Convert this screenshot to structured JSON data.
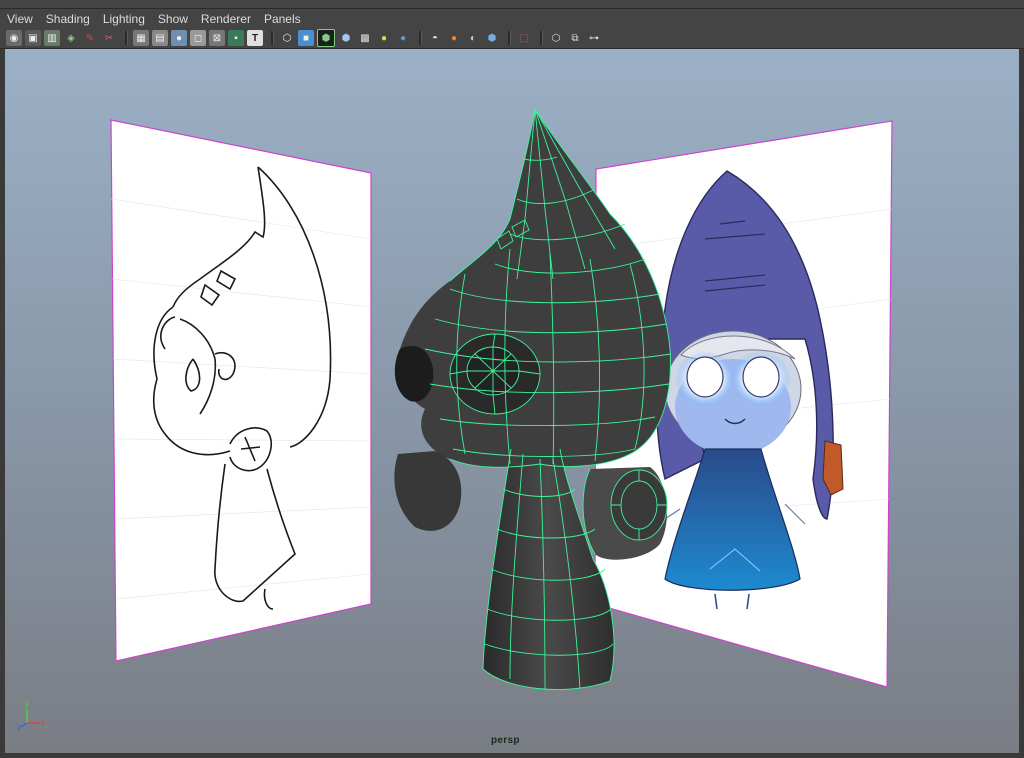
{
  "menu": {
    "items": [
      {
        "label": "View"
      },
      {
        "label": "Shading"
      },
      {
        "label": "Lighting"
      },
      {
        "label": "Show"
      },
      {
        "label": "Renderer"
      },
      {
        "label": "Panels"
      }
    ]
  },
  "toolbar": {
    "groups": [
      [
        "select-camera-icon",
        "lock-camera-icon",
        "camera-attributes-icon",
        "bookmark-icon",
        "image-plane-icon"
      ],
      [
        "grid-icon",
        "film-gate-icon",
        "resolution-gate-icon",
        "gate-mask-icon",
        "field-chart-icon",
        "safe-action-icon",
        "safe-title-icon"
      ],
      [
        "wireframe-icon",
        "smooth-shade-icon",
        "wireframe-on-shaded-icon",
        "default-material-icon",
        "textured-icon",
        "use-all-lights-icon",
        "shadows-icon"
      ],
      [
        "high-quality-icon",
        "ambient-occlusion-icon",
        "motion-blur-icon",
        "anti-aliasing-icon"
      ],
      [
        "isolate-select-icon",
        "xray-icon",
        "xray-joints-icon",
        "xray-components-icon"
      ]
    ]
  },
  "viewport": {
    "camera_label": "persp",
    "axis": {
      "y": "y",
      "z": "z",
      "x": "x"
    },
    "mesh_wire_color": "#3df59a",
    "image_plane_border_color": "#cc44cc"
  }
}
